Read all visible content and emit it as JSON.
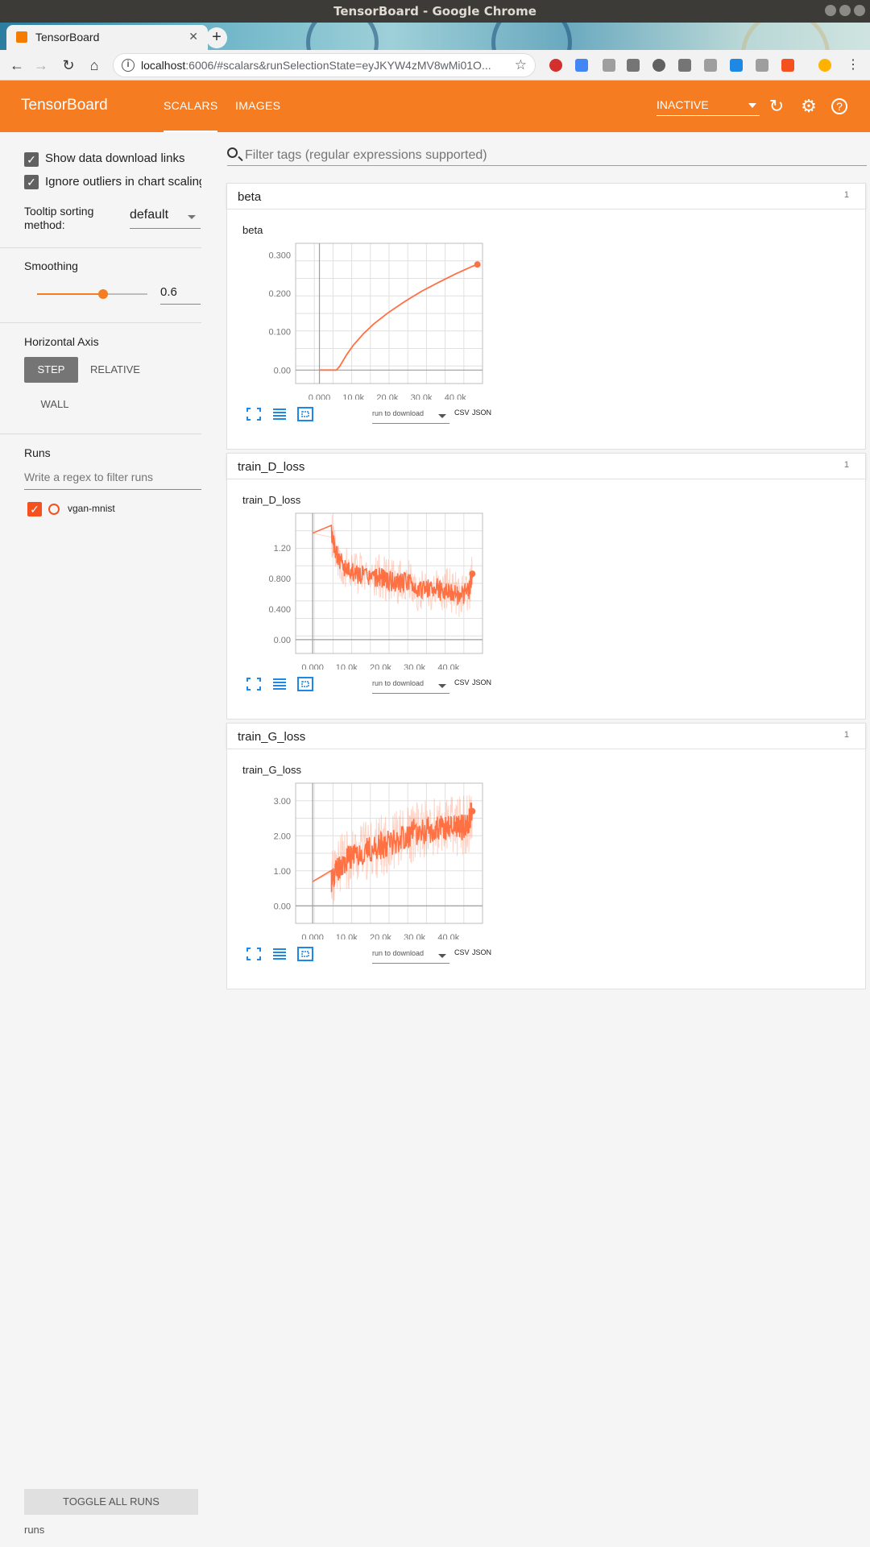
{
  "window": {
    "title": "TensorBoard - Google Chrome"
  },
  "browser": {
    "tab_title": "TensorBoard",
    "url_host": "localhost",
    "url_rest": ":6006/#scalars&runSelectionState=eyJKYW4zMV8wMi01O..."
  },
  "header": {
    "brand": "TensorBoard",
    "tabs": [
      {
        "label": "SCALARS",
        "active": true
      },
      {
        "label": "IMAGES",
        "active": false
      }
    ],
    "run_selector": "INACTIVE",
    "accent": "#f57c20"
  },
  "sidebar": {
    "show_download_links": "Show data download links",
    "ignore_outliers": "Ignore outliers in chart scaling",
    "tooltip_label": "Tooltip sorting method:",
    "tooltip_value": "default",
    "smoothing_label": "Smoothing",
    "smoothing_value": "0.6",
    "horizontal_axis_label": "Horizontal Axis",
    "axis_options": [
      "STEP",
      "RELATIVE",
      "WALL"
    ],
    "axis_selected": "STEP",
    "runs_label": "Runs",
    "runs_filter_placeholder": "Write a regex to filter runs",
    "runs": [
      {
        "name": "vgan-mnist",
        "checked": true,
        "color": "#f4511e"
      }
    ],
    "toggle_all": "TOGGLE ALL RUNS",
    "footer": "runs"
  },
  "main": {
    "filter_placeholder": "Filter tags (regular expressions supported)",
    "download_placeholder": "run to download",
    "csv": "CSV",
    "json": "JSON"
  },
  "cards": [
    {
      "category": "beta",
      "count": "1",
      "title": "beta"
    },
    {
      "category": "train_D_loss",
      "count": "1",
      "title": "train_D_loss"
    },
    {
      "category": "train_G_loss",
      "count": "1",
      "title": "train_G_loss"
    }
  ],
  "chart_data": [
    {
      "type": "line",
      "title": "beta",
      "x_ticks": [
        "0.000",
        "10.0k",
        "20.0k",
        "30.0k",
        "40.0k"
      ],
      "y_ticks": [
        "0.00",
        "0.100",
        "0.200",
        "0.300"
      ],
      "xlim": [
        -7000,
        48000
      ],
      "ylim": [
        -0.035,
        0.33
      ],
      "series": [
        {
          "color": "#ff7043",
          "x": [
            0,
            5000,
            6000,
            8000,
            10000,
            13000,
            16000,
            20000,
            25000,
            30000,
            35000,
            40000,
            45000,
            46500
          ],
          "y": [
            0,
            0,
            0.01,
            0.04,
            0.065,
            0.095,
            0.12,
            0.148,
            0.178,
            0.205,
            0.228,
            0.25,
            0.27,
            0.275
          ]
        }
      ]
    },
    {
      "type": "line",
      "title": "train_D_loss",
      "x_ticks": [
        "0.000",
        "10.0k",
        "20.0k",
        "30.0k",
        "40.0k"
      ],
      "y_ticks": [
        "0.00",
        "0.400",
        "0.800",
        "1.20"
      ],
      "xlim": [
        -5000,
        50000
      ],
      "ylim": [
        -0.18,
        1.65
      ],
      "series": [
        {
          "color": "#ff7043",
          "x": [
            0,
            5500,
            6500,
            8000,
            10000,
            12000,
            15000,
            18000,
            20000,
            22000,
            25000,
            28000,
            30000,
            33000,
            36000,
            38000,
            40000,
            42000,
            44000,
            46000,
            47000
          ],
          "y": [
            1.39,
            1.39,
            1.18,
            1.02,
            0.92,
            0.88,
            0.84,
            0.8,
            0.82,
            0.78,
            0.74,
            0.76,
            0.68,
            0.64,
            0.7,
            0.62,
            0.66,
            0.6,
            0.58,
            0.64,
            0.86
          ]
        }
      ]
    },
    {
      "type": "line",
      "title": "train_G_loss",
      "x_ticks": [
        "0.000",
        "10.0k",
        "20.0k",
        "30.0k",
        "40.0k"
      ],
      "y_ticks": [
        "0.00",
        "1.00",
        "2.00",
        "3.00"
      ],
      "xlim": [
        -5000,
        50000
      ],
      "ylim": [
        -0.5,
        3.5
      ],
      "series": [
        {
          "color": "#ff7043",
          "x": [
            0,
            5500,
            6500,
            8000,
            10000,
            12000,
            15000,
            18000,
            20000,
            22000,
            25000,
            28000,
            30000,
            33000,
            36000,
            38000,
            40000,
            42000,
            44000,
            46000,
            47000
          ],
          "y": [
            0.69,
            0.69,
            0.95,
            1.15,
            1.3,
            1.45,
            1.55,
            1.62,
            1.7,
            1.8,
            1.9,
            2.0,
            2.1,
            2.15,
            2.2,
            2.2,
            2.25,
            2.3,
            2.25,
            2.4,
            2.7
          ]
        }
      ]
    }
  ]
}
